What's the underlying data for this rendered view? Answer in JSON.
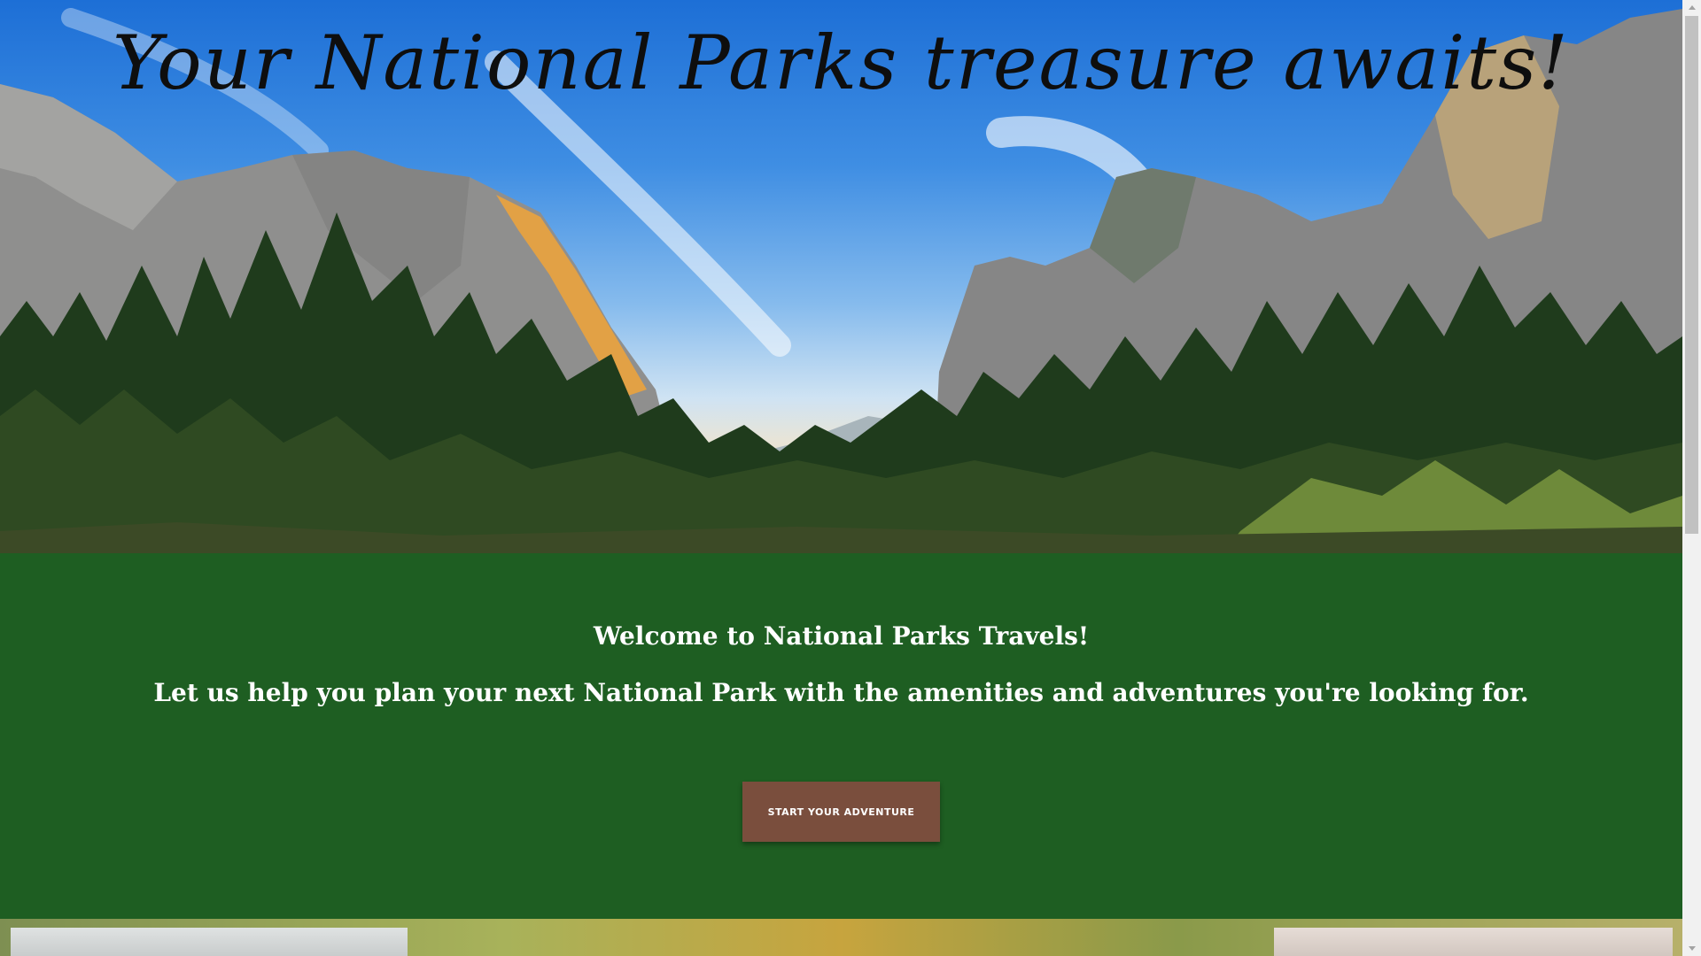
{
  "hero": {
    "title": "Your National Parks treasure awaits!"
  },
  "welcome": {
    "line1": "Welcome to National Parks Travels!",
    "line2": "Let us help you plan your next National Park with the amenities and adventures you're looking for.",
    "cta_label": "START YOUR ADVENTURE"
  },
  "colors": {
    "section_green": "#1e5e22",
    "button_brown": "#7a4e3d",
    "text_white": "#ffffff"
  },
  "scrollbar": {
    "up_icon": "chevron-up-icon",
    "down_icon": "chevron-down-icon"
  }
}
